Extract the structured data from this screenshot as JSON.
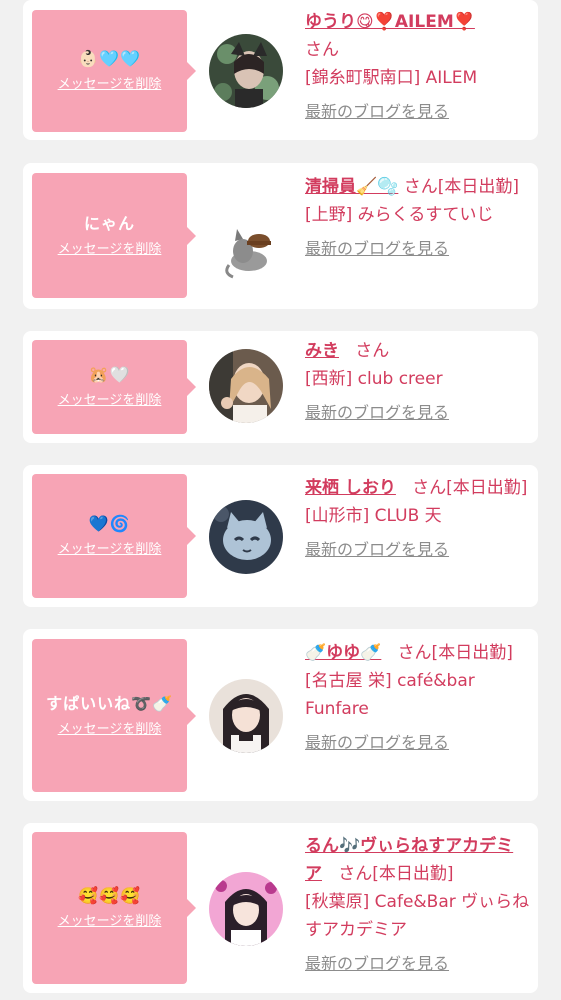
{
  "items": [
    {
      "message": "👶🏻🩵🩵",
      "delete_label": "メッセージを削除",
      "name": "ゆうり😋❣️AILEM❣️",
      "suffix": "さん",
      "shop": "[錦糸町駅南口] AILEM",
      "blog_label": "最新のブログを見る"
    },
    {
      "message": "にゃん",
      "delete_label": "メッセージを削除",
      "name": "清掃員🧹🫧",
      "suffix": "さん[本日出勤]",
      "shop": "[上野] みらくるすていじ",
      "blog_label": "最新のブログを見る"
    },
    {
      "message": "🐹🤍",
      "delete_label": "メッセージを削除",
      "name": "みき",
      "suffix": "さん",
      "shop": "[西新] club creer",
      "blog_label": "最新のブログを見る"
    },
    {
      "message": "💙🌀",
      "delete_label": "メッセージを削除",
      "name": "来栖 しおり",
      "suffix": "さん[本日出勤]",
      "shop": "[山形市] CLUB 天",
      "blog_label": "最新のブログを見る"
    },
    {
      "message": "すぱいいね➰🍼",
      "delete_label": "メッセージを削除",
      "name": "🍼ゆゆ🍼",
      "suffix": "さん[本日出勤]",
      "shop": "[名古屋 栄] café&bar Funfare",
      "blog_label": "最新のブログを見る"
    },
    {
      "message": "🥰🥰🥰",
      "delete_label": "メッセージを削除",
      "name": "るん🎶ヴぃらねすアカデミア",
      "suffix": "さん[本日出勤]",
      "shop": "[秋葉原] Cafe&Bar ヴぃらねすアカデミア",
      "blog_label": "最新のブログを見る"
    }
  ]
}
